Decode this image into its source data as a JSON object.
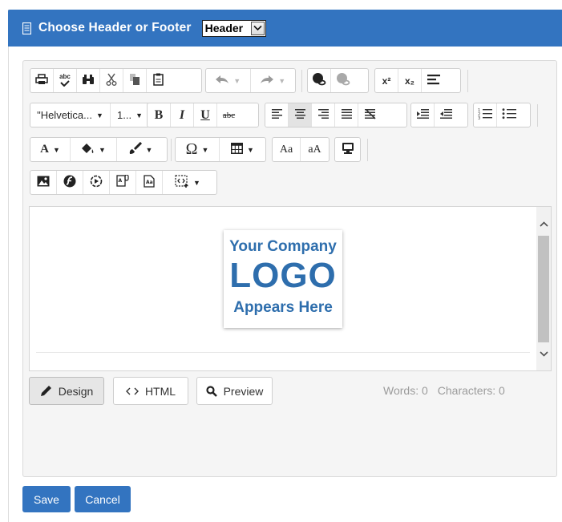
{
  "dialog": {
    "title": "Choose Header or Footer",
    "selected_section": "Header"
  },
  "toolbar": {
    "font_family": "\"Helvetica...",
    "font_size": "1...",
    "bold": "B",
    "italic": "I",
    "underline": "U",
    "strikethrough": "abc",
    "spellcheck_label": "abc",
    "superscript": "x²",
    "subscript": "x₂",
    "font_color": "A",
    "special_char": "Ω",
    "case_title": "Aa",
    "case_lower": "aA"
  },
  "logo": {
    "line1": "Your Company",
    "line2": "LOGO",
    "line3": "Appears Here",
    "color": "#2e6ead"
  },
  "modes": {
    "design": "Design",
    "html": "HTML",
    "preview": "Preview"
  },
  "stats": {
    "words": "Words: 0",
    "characters": "Characters: 0"
  },
  "actions": {
    "save": "Save",
    "cancel": "Cancel"
  },
  "colors": {
    "accent": "#3374c0",
    "panel": "#f5f5f5"
  }
}
